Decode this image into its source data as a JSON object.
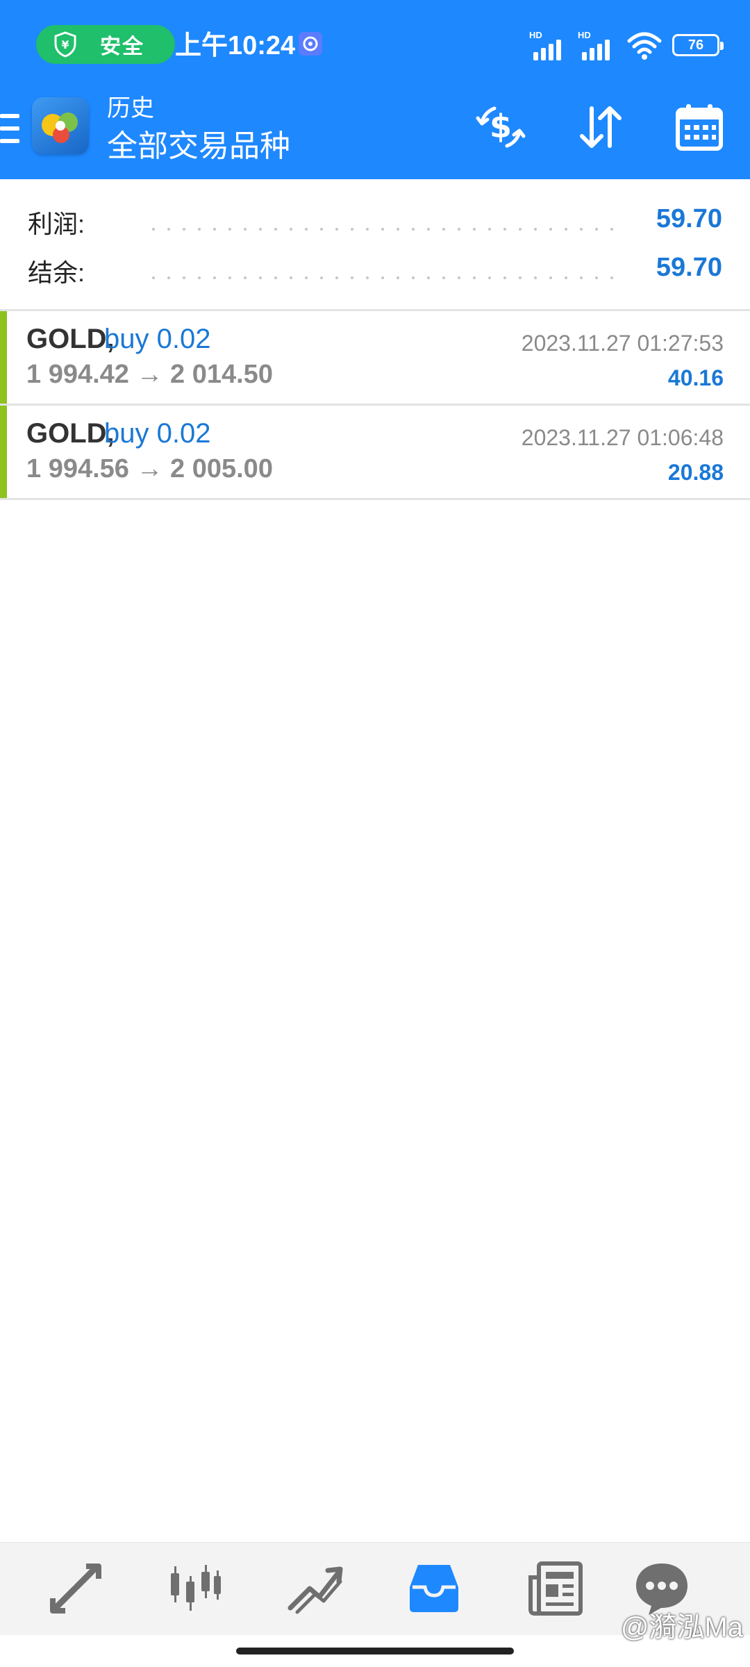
{
  "status_bar": {
    "safe_label": "安全",
    "time": "上午10:24",
    "signal_1_label": "HD",
    "signal_2_label": "HD",
    "battery": "76"
  },
  "app_bar": {
    "subtitle": "历史",
    "title": "全部交易品种"
  },
  "summary": {
    "profit_label": "利润:",
    "profit_value": "59.70",
    "balance_label": "结余:",
    "balance_value": "59.70"
  },
  "trades": [
    {
      "symbol": "GOLD,",
      "side": "buy 0.02",
      "prices": "1 994.42 → 2 014.50",
      "time": "2023.11.27 01:27:53",
      "profit": "40.16"
    },
    {
      "symbol": "GOLD,",
      "side": "buy 0.02",
      "prices": "1 994.56 → 2 005.00",
      "time": "2023.11.27 01:06:48",
      "profit": "20.88"
    }
  ],
  "watermark": "@漪泓Ma",
  "colors": {
    "header_blue": "#1e88ff",
    "accent_blue": "#1a78d6",
    "buy_indicator": "#8dc21f",
    "safe_green": "#1fbf6b"
  },
  "icons": {
    "header_actions": [
      "currency-exchange-icon",
      "sort-icon",
      "calendar-icon"
    ],
    "nav": [
      "quotes-icon",
      "chart-icon",
      "trade-icon",
      "history-icon",
      "news-icon",
      "chat-icon"
    ],
    "active_nav": "history-icon"
  }
}
